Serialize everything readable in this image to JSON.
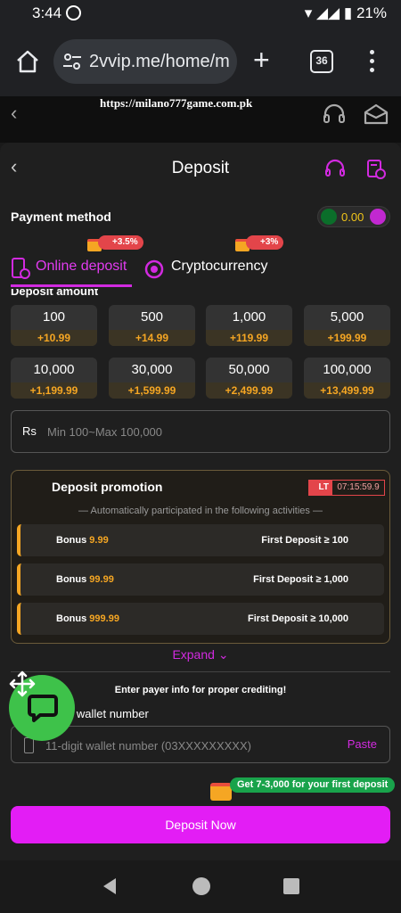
{
  "status_bar": {
    "time": "3:44",
    "battery": "21%"
  },
  "browser": {
    "url": "2vvip.me/home/m",
    "tab_count": "36"
  },
  "site": {
    "watermark_url": "https://milano777game.com.pk"
  },
  "deposit": {
    "title": "Deposit",
    "payment_method_label": "Payment method",
    "balance": "0.00",
    "methods": [
      {
        "label": "Online deposit",
        "bonus": "+3.5%",
        "active": true
      },
      {
        "label": "Cryptocurrency",
        "bonus": "+3%",
        "active": false
      }
    ],
    "amount_label": "Deposit amount",
    "amounts": [
      {
        "value": "100",
        "bonus": "+10.99"
      },
      {
        "value": "500",
        "bonus": "+14.99"
      },
      {
        "value": "1,000",
        "bonus": "+119.99"
      },
      {
        "value": "5,000",
        "bonus": "+199.99"
      },
      {
        "value": "10,000",
        "bonus": "+1,199.99"
      },
      {
        "value": "30,000",
        "bonus": "+1,599.99"
      },
      {
        "value": "50,000",
        "bonus": "+2,499.99"
      },
      {
        "value": "100,000",
        "bonus": "+13,499.99"
      }
    ],
    "amount_input": {
      "currency": "Rs",
      "placeholder": "Min 100~Max 100,000",
      "value": ""
    },
    "promotion": {
      "title": "Deposit promotion",
      "lt_label": "LT",
      "timer": "07:15:59.9",
      "subtitle": "— Automatically participated in the following activities —",
      "rows": [
        {
          "bonus_label": "Bonus",
          "bonus_value": "9.99",
          "condition": "First Deposit ≥ 100"
        },
        {
          "bonus_label": "Bonus",
          "bonus_value": "99.99",
          "condition": "First Deposit ≥ 1,000"
        },
        {
          "bonus_label": "Bonus",
          "bonus_value": "999.99",
          "condition": "First Deposit ≥ 10,000"
        }
      ]
    },
    "expand_label": "Expand",
    "payer_note": "Enter payer info for proper crediting!",
    "wallet_label": "bile wallet number",
    "wallet_input": {
      "placeholder": "11-digit wallet number (03XXXXXXXXX)",
      "value": ""
    },
    "paste_label": "Paste",
    "first_deposit_badge": "Get 7-3,000 for your first deposit",
    "submit_label": "Deposit Now"
  },
  "colors": {
    "accent": "#e31df5",
    "gold": "#f5a623",
    "green": "#3ec24a"
  }
}
